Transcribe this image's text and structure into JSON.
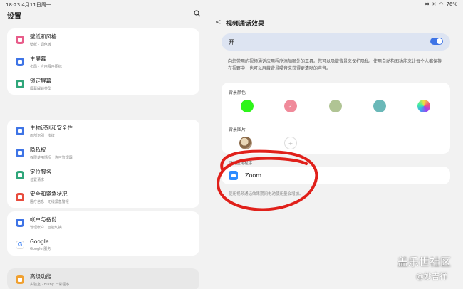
{
  "status_bar": {
    "time": "18:23",
    "date": "4月11日周一",
    "battery": "76%"
  },
  "settings": {
    "title": "设置",
    "groups": [
      [
        {
          "title": "壁纸和风格",
          "sub": "壁纸 · 调色板",
          "color": "#e85c8a"
        },
        {
          "title": "主屏幕",
          "sub": "布局 · 应用程序图标",
          "color": "#3e74e6"
        },
        {
          "title": "锁定屏幕",
          "sub": "屏幕解锁类型",
          "color": "#2fa67a"
        }
      ],
      [
        {
          "title": "生物识别和安全性",
          "sub": "面部识别 · 指纹",
          "color": "#3e74e6"
        },
        {
          "title": "隐私权",
          "sub": "权限使用情况 · 许可管理器",
          "color": "#3e74e6"
        },
        {
          "title": "定位服务",
          "sub": "位置请求",
          "color": "#2fa67a"
        },
        {
          "title": "安全和紧急状况",
          "sub": "医疗信息 · 无线紧急警报",
          "color": "#e84c3d"
        }
      ],
      [
        {
          "title": "帐户与备份",
          "sub": "管理帐户 · 智能切换",
          "color": "#3e74e6"
        },
        {
          "title": "Google",
          "sub": "Google 服务",
          "color": "#ffffff"
        }
      ],
      [
        {
          "title": "高级功能",
          "sub": "实验室 · Bixby 日常程序",
          "color": "#f0a030"
        }
      ]
    ]
  },
  "detail": {
    "title": "视频通话效果",
    "toggle_label": "开",
    "toggle_on": true,
    "description": "向您常用的视频通话应用程序添加额外的工具。您可以隐藏背景来保护隐私、使用自动构图功能来让每个人都保持在视野中，也可以屏蔽背景噪音来获得更清晰的声音。",
    "bg_color_label": "背景颜色",
    "swatches": [
      "#2ef51a",
      "#f08a9a",
      "#b0c494",
      "#6ab8b8",
      "gradient"
    ],
    "bg_image_label": "背景图片",
    "apps_label": "可用应用程序",
    "app_name": "Zoom",
    "note": "使用视频通话效果期间电池使用量会增加。"
  },
  "watermark": {
    "line1": "盖乐世社区",
    "line2": "@妙吉祥"
  },
  "colors": {
    "accent": "#3e74e6",
    "annotation": "#e0201a"
  }
}
